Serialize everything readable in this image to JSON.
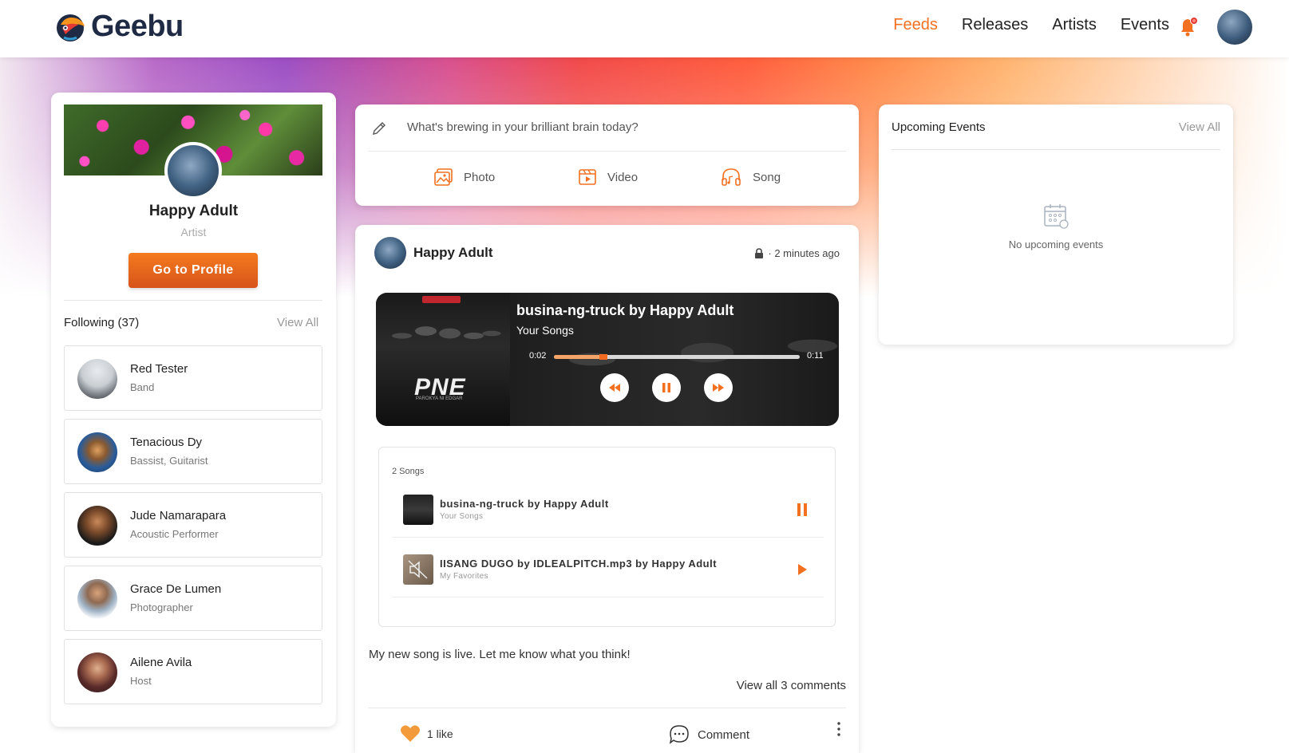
{
  "header": {
    "brand": "Geebu",
    "nav": [
      {
        "label": "Feeds",
        "active": true
      },
      {
        "label": "Releases",
        "active": false
      },
      {
        "label": "Artists",
        "active": false
      },
      {
        "label": "Events",
        "active": false
      }
    ],
    "notification_icon": "bell-icon"
  },
  "colors": {
    "accent": "#f37021",
    "button_top": "#f47a1f",
    "button_bottom": "#d7541a"
  },
  "profile": {
    "name": "Happy Adult",
    "role": "Artist",
    "button_label": "Go to Profile",
    "following_label": "Following (37)",
    "view_all_label": "View All",
    "following": [
      {
        "name": "Red Tester",
        "role": "Band"
      },
      {
        "name": "Tenacious Dy",
        "role": "Bassist, Guitarist"
      },
      {
        "name": "Jude Namarapara",
        "role": "Acoustic Performer"
      },
      {
        "name": "Grace De Lumen",
        "role": "Photographer"
      },
      {
        "name": "Ailene Avila",
        "role": "Host"
      }
    ]
  },
  "composer": {
    "placeholder": "What's brewing in your brilliant brain today?",
    "photo_label": "Photo",
    "video_label": "Video",
    "song_label": "Song"
  },
  "post": {
    "author": "Happy Adult",
    "time": "· 2 minutes ago",
    "player": {
      "title": "busina-ng-truck by Happy Adult",
      "subtitle": "Your Songs",
      "current_time": "0:02",
      "total_time": "0:11",
      "progress": 0.2,
      "art_title": "PNE",
      "art_subtitle": "PAROKYA NI EDGAR"
    },
    "playlist": {
      "count_label": "2 Songs",
      "tracks": [
        {
          "title": "busina-ng-truck by Happy Adult",
          "subtitle": "Your Songs",
          "state": "playing"
        },
        {
          "title": "IISANG DUGO by IDLEALPITCH.mp3 by Happy Adult",
          "subtitle": "My Favorites",
          "state": "paused"
        }
      ]
    },
    "text": "My new song is live. Let me know what you think!",
    "view_comments": "View all 3 comments",
    "likes": "1 like",
    "comment_label": "Comment"
  },
  "events": {
    "title": "Upcoming Events",
    "view_all_label": "View All",
    "empty_text": "No upcoming events"
  }
}
